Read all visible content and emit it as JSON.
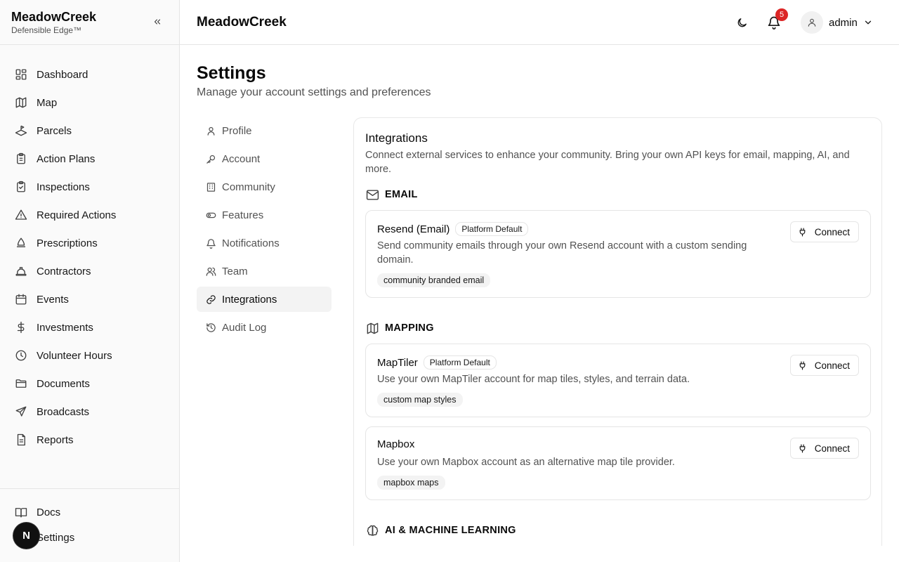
{
  "brand": {
    "name": "MeadowCreek",
    "tagline": "Defensible Edge™"
  },
  "sidebar": {
    "items": [
      {
        "label": "Dashboard",
        "icon": "dashboard-icon"
      },
      {
        "label": "Map",
        "icon": "map-icon"
      },
      {
        "label": "Parcels",
        "icon": "parcels-icon"
      },
      {
        "label": "Action Plans",
        "icon": "clipboard-icon"
      },
      {
        "label": "Inspections",
        "icon": "clipboard-check-icon"
      },
      {
        "label": "Required Actions",
        "icon": "warning-icon"
      },
      {
        "label": "Prescriptions",
        "icon": "flask-icon"
      },
      {
        "label": "Contractors",
        "icon": "hard-hat-icon"
      },
      {
        "label": "Events",
        "icon": "calendar-icon"
      },
      {
        "label": "Investments",
        "icon": "dollar-icon"
      },
      {
        "label": "Volunteer Hours",
        "icon": "clock-icon"
      },
      {
        "label": "Documents",
        "icon": "folder-icon"
      },
      {
        "label": "Broadcasts",
        "icon": "send-icon"
      },
      {
        "label": "Reports",
        "icon": "file-icon"
      }
    ],
    "bottom": [
      {
        "label": "Docs",
        "icon": "book-icon"
      },
      {
        "label": "Settings",
        "icon": "settings-icon"
      }
    ],
    "nx_badge": "N"
  },
  "header": {
    "title": "MeadowCreek",
    "notification_count": "5",
    "user_name": "admin"
  },
  "page": {
    "title": "Settings",
    "subtitle": "Manage your account settings and preferences"
  },
  "settings_nav": {
    "items": [
      {
        "label": "Profile"
      },
      {
        "label": "Account"
      },
      {
        "label": "Community"
      },
      {
        "label": "Features"
      },
      {
        "label": "Notifications"
      },
      {
        "label": "Team"
      },
      {
        "label": "Integrations"
      },
      {
        "label": "Audit Log"
      }
    ],
    "active": "Integrations"
  },
  "integrations": {
    "title": "Integrations",
    "description": "Connect external services to enhance your community. Bring your own API keys for email, mapping, AI, and more.",
    "connect_label": "Connect",
    "sections": [
      {
        "heading": "EMAIL",
        "cards": [
          {
            "title": "Resend (Email)",
            "badge": "Platform Default",
            "description": "Send community emails through your own Resend account with a custom sending domain.",
            "chip": "community branded email"
          }
        ]
      },
      {
        "heading": "MAPPING",
        "cards": [
          {
            "title": "MapTiler",
            "badge": "Platform Default",
            "description": "Use your own MapTiler account for map tiles, styles, and terrain data.",
            "chip": "custom map styles"
          },
          {
            "title": "Mapbox",
            "badge": "",
            "description": "Use your own Mapbox account as an alternative map tile provider.",
            "chip": "mapbox maps"
          }
        ]
      },
      {
        "heading": "AI & MACHINE LEARNING",
        "cards": []
      }
    ]
  }
}
